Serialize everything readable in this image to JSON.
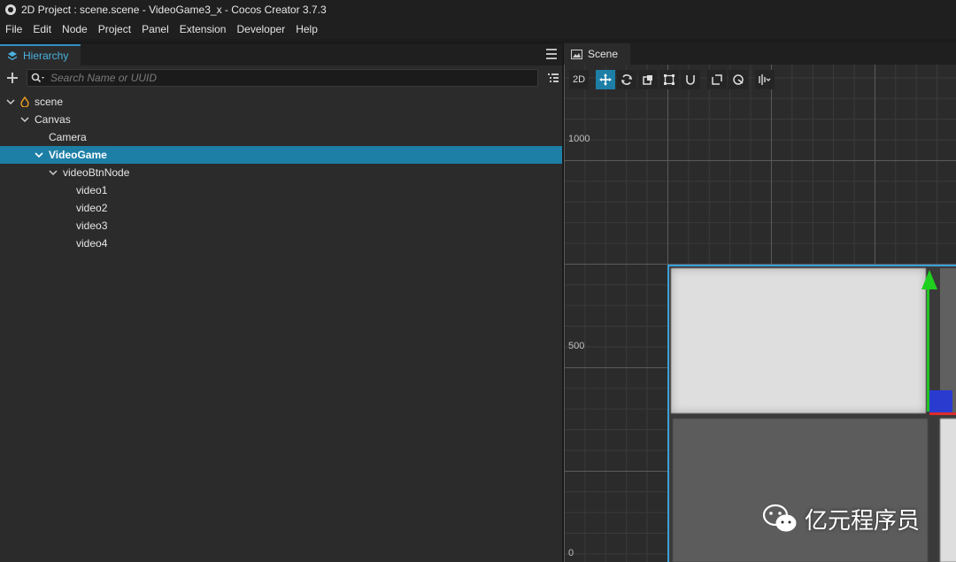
{
  "window": {
    "title": "2D Project : scene.scene - VideoGame3_x - Cocos Creator 3.7.3"
  },
  "menu": [
    "File",
    "Edit",
    "Node",
    "Project",
    "Panel",
    "Extension",
    "Developer",
    "Help"
  ],
  "hierarchy": {
    "tab_label": "Hierarchy",
    "search_placeholder": "Search Name or UUID",
    "nodes": [
      {
        "label": "scene",
        "depth": 0,
        "expanded": true,
        "selected": false
      },
      {
        "label": "Canvas",
        "depth": 1,
        "expanded": true,
        "selected": false
      },
      {
        "label": "Camera",
        "depth": 2,
        "expanded": false,
        "selected": false
      },
      {
        "label": "VideoGame",
        "depth": 2,
        "expanded": true,
        "selected": true
      },
      {
        "label": "videoBtnNode",
        "depth": 3,
        "expanded": true,
        "selected": false
      },
      {
        "label": "video1",
        "depth": 4,
        "expanded": false,
        "selected": false
      },
      {
        "label": "video2",
        "depth": 4,
        "expanded": false,
        "selected": false
      },
      {
        "label": "video3",
        "depth": 4,
        "expanded": false,
        "selected": false
      },
      {
        "label": "video4",
        "depth": 4,
        "expanded": false,
        "selected": false
      }
    ]
  },
  "scene": {
    "tab_label": "Scene",
    "mode_2d": "2D",
    "y_labels": [
      "1000",
      "500",
      "0"
    ]
  },
  "watermark": {
    "text": "亿元程序员"
  },
  "colors": {
    "selection": "#1d7fa6",
    "accent": "#4ab2e0",
    "gizmo_y": "#1fc21f",
    "gizmo_x": "#e02a2a",
    "gizmo_z": "#2a3bd0"
  }
}
